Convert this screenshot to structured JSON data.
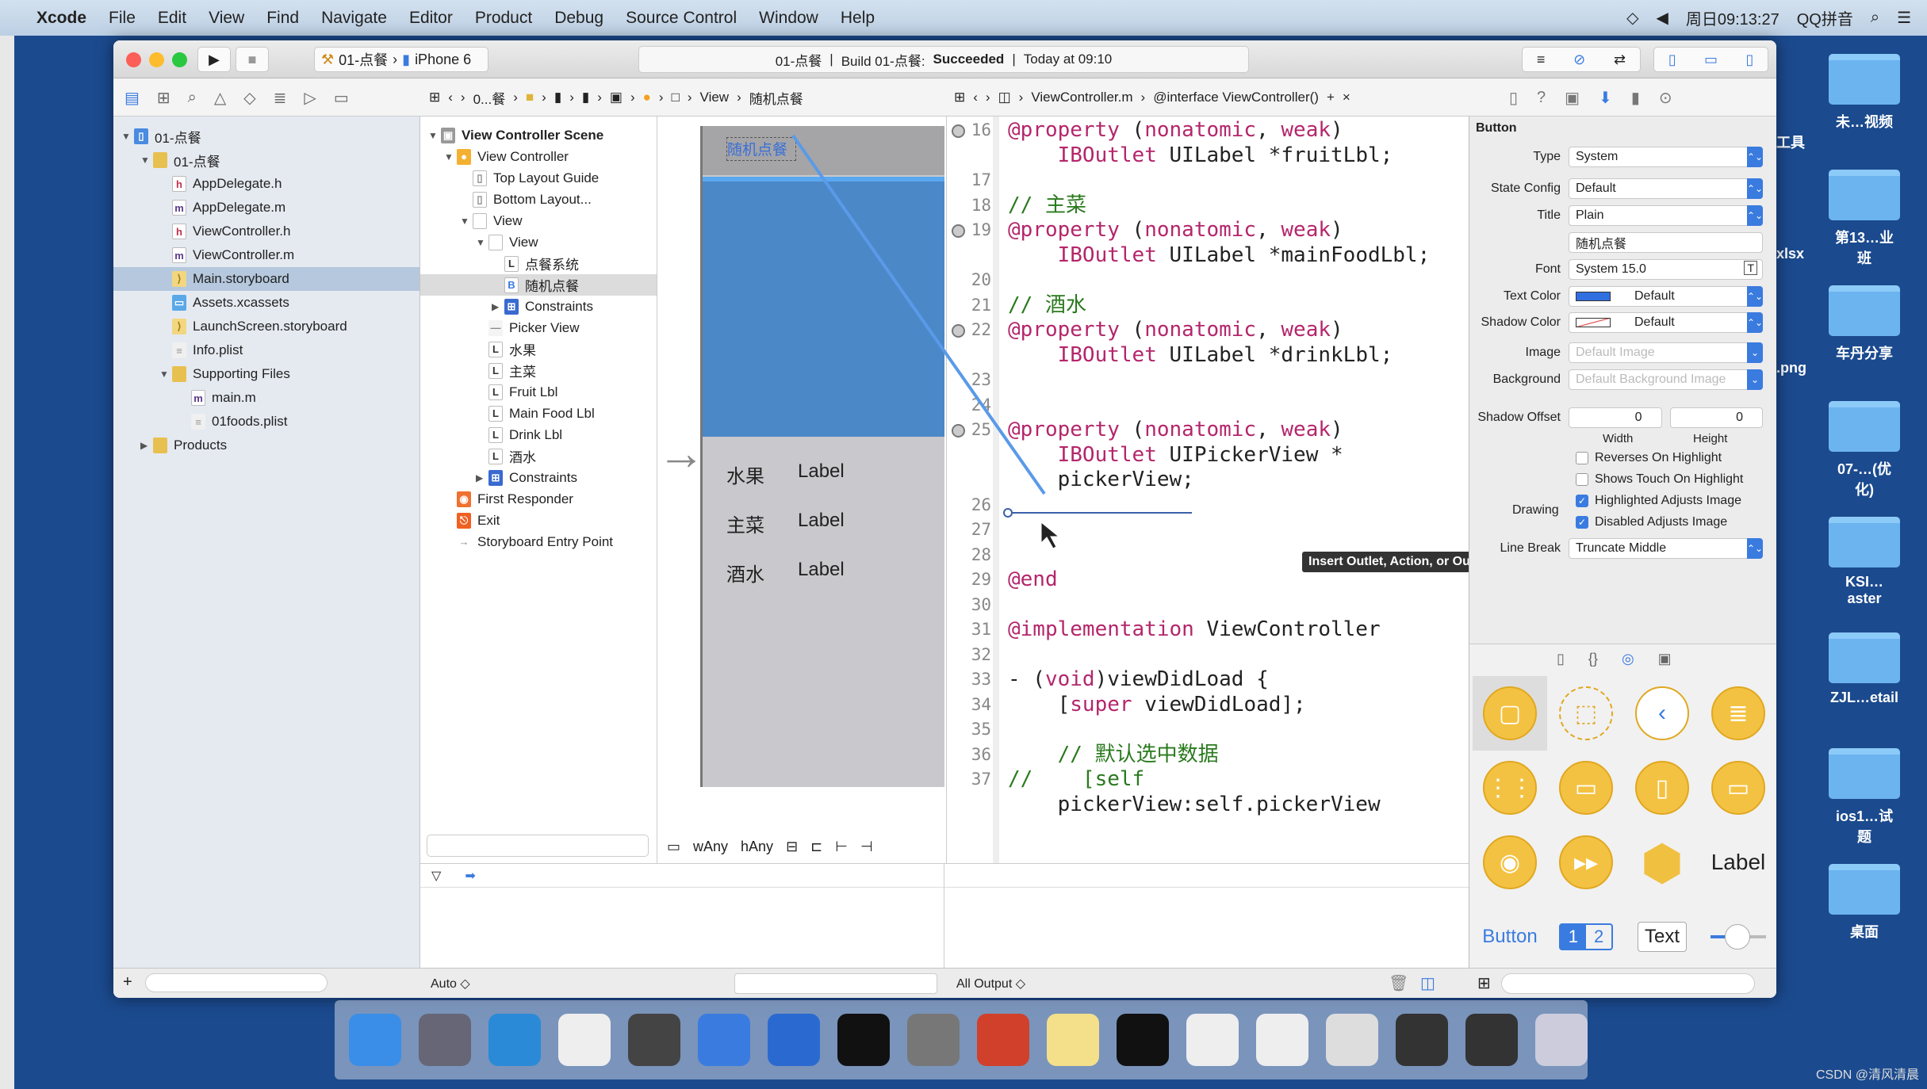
{
  "menubar": {
    "app": "Xcode",
    "items": [
      "File",
      "Edit",
      "View",
      "Find",
      "Navigate",
      "Editor",
      "Product",
      "Debug",
      "Source Control",
      "Window",
      "Help"
    ],
    "clock": "周日09:13:27",
    "input_method": "QQ拼音"
  },
  "toolbar": {
    "scheme": "01-点餐",
    "device": "iPhone 6",
    "activity_project": "01-点餐",
    "activity_build": "Build 01-点餐:",
    "activity_status": "Succeeded",
    "activity_time": "Today at 09:10"
  },
  "jumpbar": {
    "storyboard_path": [
      "0...餐",
      "View",
      "随机点餐"
    ],
    "code_path": [
      "ViewController.m",
      "@interface ViewController()"
    ]
  },
  "navigator": {
    "items": [
      {
        "label": "01-点餐",
        "indent": 0,
        "icon": "project",
        "tri": "▼"
      },
      {
        "label": "01-点餐",
        "indent": 1,
        "icon": "folder",
        "tri": "▼"
      },
      {
        "label": "AppDelegate.h",
        "indent": 2,
        "icon": "h"
      },
      {
        "label": "AppDelegate.m",
        "indent": 2,
        "icon": "m"
      },
      {
        "label": "ViewController.h",
        "indent": 2,
        "icon": "h"
      },
      {
        "label": "ViewController.m",
        "indent": 2,
        "icon": "m"
      },
      {
        "label": "Main.storyboard",
        "indent": 2,
        "icon": "storyboard",
        "selected": true
      },
      {
        "label": "Assets.xcassets",
        "indent": 2,
        "icon": "assets"
      },
      {
        "label": "LaunchScreen.storyboard",
        "indent": 2,
        "icon": "storyboard"
      },
      {
        "label": "Info.plist",
        "indent": 2,
        "icon": "plist"
      },
      {
        "label": "Supporting Files",
        "indent": 2,
        "icon": "folder",
        "tri": "▼"
      },
      {
        "label": "main.m",
        "indent": 3,
        "icon": "m"
      },
      {
        "label": "01foods.plist",
        "indent": 3,
        "icon": "plist"
      },
      {
        "label": "Products",
        "indent": 1,
        "icon": "folder",
        "tri": "▶"
      }
    ]
  },
  "outline": {
    "items": [
      {
        "label": "View Controller Scene",
        "indent": 0,
        "icon": "scene",
        "tri": "▼",
        "bold": true
      },
      {
        "label": "View Controller",
        "indent": 1,
        "icon": "vc",
        "tri": "▼"
      },
      {
        "label": "Top Layout Guide",
        "indent": 2,
        "icon": "guide"
      },
      {
        "label": "Bottom Layout...",
        "indent": 2,
        "icon": "guide"
      },
      {
        "label": "View",
        "indent": 2,
        "icon": "view",
        "tri": "▼"
      },
      {
        "label": "View",
        "indent": 3,
        "icon": "view",
        "tri": "▼"
      },
      {
        "label": "点餐系统",
        "indent": 4,
        "icon": "L"
      },
      {
        "label": "随机点餐",
        "indent": 4,
        "icon": "B",
        "selected": true
      },
      {
        "label": "Constraints",
        "indent": 4,
        "icon": "constraints",
        "tri": "▶"
      },
      {
        "label": "Picker View",
        "indent": 3,
        "icon": "picker"
      },
      {
        "label": "水果",
        "indent": 3,
        "icon": "L"
      },
      {
        "label": "主菜",
        "indent": 3,
        "icon": "L"
      },
      {
        "label": "Fruit Lbl",
        "indent": 3,
        "icon": "L"
      },
      {
        "label": "Main Food Lbl",
        "indent": 3,
        "icon": "L"
      },
      {
        "label": "Drink Lbl",
        "indent": 3,
        "icon": "L"
      },
      {
        "label": "酒水",
        "indent": 3,
        "icon": "L"
      },
      {
        "label": "Constraints",
        "indent": 3,
        "icon": "constraints",
        "tri": "▶"
      },
      {
        "label": "First Responder",
        "indent": 1,
        "icon": "responder"
      },
      {
        "label": "Exit",
        "indent": 1,
        "icon": "exit"
      },
      {
        "label": "Storyboard Entry Point",
        "indent": 1,
        "icon": "arrow"
      }
    ]
  },
  "canvas": {
    "button_title": "随机点餐",
    "rows": [
      {
        "name": "水果",
        "value": "Label"
      },
      {
        "name": "主菜",
        "value": "Label"
      },
      {
        "name": "酒水",
        "value": "Label"
      }
    ],
    "size_class_w": "wAny",
    "size_class_h": "hAny"
  },
  "code": {
    "lines": [
      {
        "n": "16",
        "rows": [
          "@property (nonatomic, weak)",
          "    IBOutlet UILabel *fruitLbl;"
        ],
        "connected": true
      },
      {
        "n": "17",
        "rows": [
          ""
        ]
      },
      {
        "n": "18",
        "rows": [
          "// 主菜"
        ]
      },
      {
        "n": "19",
        "rows": [
          "@property (nonatomic, weak)",
          "    IBOutlet UILabel *mainFoodLbl;"
        ],
        "connected": true
      },
      {
        "n": "20",
        "rows": [
          ""
        ]
      },
      {
        "n": "21",
        "rows": [
          "// 酒水"
        ]
      },
      {
        "n": "22",
        "rows": [
          "@property (nonatomic, weak)",
          "    IBOutlet UILabel *drinkLbl;"
        ],
        "connected": true
      },
      {
        "n": "23",
        "rows": [
          ""
        ]
      },
      {
        "n": "24",
        "rows": [
          ""
        ]
      },
      {
        "n": "25",
        "rows": [
          "@property (nonatomic, weak)",
          "    IBOutlet UIPickerView *",
          "    pickerView;"
        ],
        "connected": true
      },
      {
        "n": "26",
        "rows": [
          ""
        ]
      },
      {
        "n": "27",
        "rows": [
          ""
        ]
      },
      {
        "n": "28",
        "rows": [
          ""
        ]
      },
      {
        "n": "29",
        "rows": [
          "@end"
        ]
      },
      {
        "n": "30",
        "rows": [
          ""
        ]
      },
      {
        "n": "31",
        "rows": [
          "@implementation ViewController"
        ]
      },
      {
        "n": "32",
        "rows": [
          ""
        ]
      },
      {
        "n": "33",
        "rows": [
          "- (void)viewDidLoad {"
        ]
      },
      {
        "n": "34",
        "rows": [
          "    [super viewDidLoad];"
        ]
      },
      {
        "n": "35",
        "rows": [
          ""
        ]
      },
      {
        "n": "36",
        "rows": [
          "    // 默认选中数据"
        ]
      },
      {
        "n": "37",
        "rows": [
          "//    [self",
          "    pickerView:self.pickerView"
        ]
      }
    ],
    "tooltip": "Insert Outlet, Action, or Outlet Collection"
  },
  "inspector": {
    "section": "Button",
    "type": "System",
    "state_config": "Default",
    "title_style": "Plain",
    "title_text": "随机点餐",
    "font": "System 15.0",
    "text_color": "Default",
    "text_color_swatch": "#2f6fe0",
    "shadow_color": "Default",
    "image_placeholder": "Default Image",
    "background_placeholder": "Default Background Image",
    "shadow_offset_width": "0",
    "shadow_offset_height": "0",
    "width_label": "Width",
    "height_label": "Height",
    "drawing_label": "Drawing",
    "labels": {
      "type": "Type",
      "state_config": "State Config",
      "title": "Title",
      "font": "Font",
      "text_color": "Text Color",
      "shadow_color": "Shadow Color",
      "image": "Image",
      "background": "Background",
      "shadow_offset": "Shadow Offset",
      "line_break": "Line Break"
    },
    "checkboxes": [
      {
        "label": "Reverses On Highlight",
        "checked": false
      },
      {
        "label": "Shows Touch On Highlight",
        "checked": false
      },
      {
        "label": "Highlighted Adjusts Image",
        "checked": true
      },
      {
        "label": "Disabled Adjusts Image",
        "checked": true
      }
    ],
    "line_break": "Truncate Middle"
  },
  "library": {
    "text_items": {
      "label": "Label",
      "button": "Button",
      "text": "Text",
      "seg1": "1",
      "seg2": "2"
    }
  },
  "debug": {
    "auto": "Auto ◇",
    "all_output": "All Output ◇"
  },
  "desktop": {
    "items": [
      "未…视频",
      "第13…业班",
      "车丹分享",
      "07-…(优化)",
      "KSI…aster",
      "ZJL…etail",
      "ios1…试题",
      "桌面"
    ],
    "partial": [
      "工具",
      "xlsx",
      ".png"
    ]
  },
  "dock": {
    "icons": [
      "finder",
      "launchpad",
      "safari",
      "mouse",
      "photo-booth",
      "xcode",
      "instruments",
      "terminal",
      "system-preferences",
      "powerpoint",
      "notes",
      "console",
      "preview-1",
      "preview-2",
      "preview-3",
      "screen-1",
      "screen-2",
      "trash"
    ]
  },
  "watermark": "CSDN @清风清晨",
  "colors": {
    "accent": "#3a7be0",
    "desktop": "#1b4a8e",
    "canvas_blue": "#4a88c8"
  }
}
